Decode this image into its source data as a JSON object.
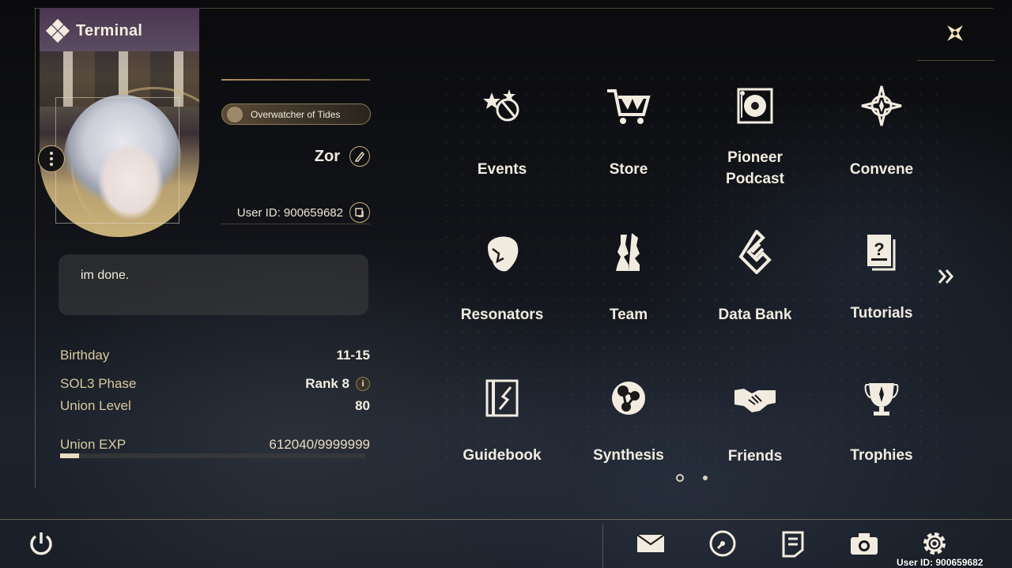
{
  "window": {
    "title": "Terminal"
  },
  "profile": {
    "title_badge": "Overwatcher of Tides",
    "name": "Zor",
    "user_id_label": "User ID: 900659682",
    "signature": "im done."
  },
  "stats": {
    "birthday_label": "Birthday",
    "birthday_value": "11-15",
    "sol3_label": "SOL3 Phase",
    "sol3_value": "Rank 8",
    "union_level_label": "Union Level",
    "union_level_value": "80",
    "union_exp_label": "Union EXP",
    "union_exp_value": "612040/9999999",
    "union_exp_fraction": 0.061
  },
  "menu": {
    "events": "Events",
    "store": "Store",
    "pioneer_podcast": "Pioneer\nPodcast",
    "convene": "Convene",
    "resonators": "Resonators",
    "team": "Team",
    "data_bank": "Data Bank",
    "tutorials": "Tutorials",
    "guidebook": "Guidebook",
    "synthesis": "Synthesis",
    "friends": "Friends",
    "trophies": "Trophies"
  },
  "pagination": {
    "current": 1,
    "total": 2
  },
  "footer": {
    "user_id": "User ID: 900659682"
  },
  "icons": [
    "diamond-logo-icon",
    "close-icon",
    "more-icon",
    "edit-icon",
    "copy-icon",
    "info-icon",
    "events-icon",
    "store-icon",
    "podcast-icon",
    "convene-icon",
    "resonators-icon",
    "team-icon",
    "data-bank-icon",
    "tutorials-icon",
    "guidebook-icon",
    "synthesis-icon",
    "friends-icon",
    "trophies-icon",
    "chevron-double-right-icon",
    "power-icon",
    "mail-icon",
    "clock-icon",
    "notice-icon",
    "camera-icon",
    "settings-icon"
  ],
  "colors": {
    "accent_gold": "#c9b27a",
    "text_light": "#f2ece0",
    "label_gold": "#d8c99e"
  }
}
